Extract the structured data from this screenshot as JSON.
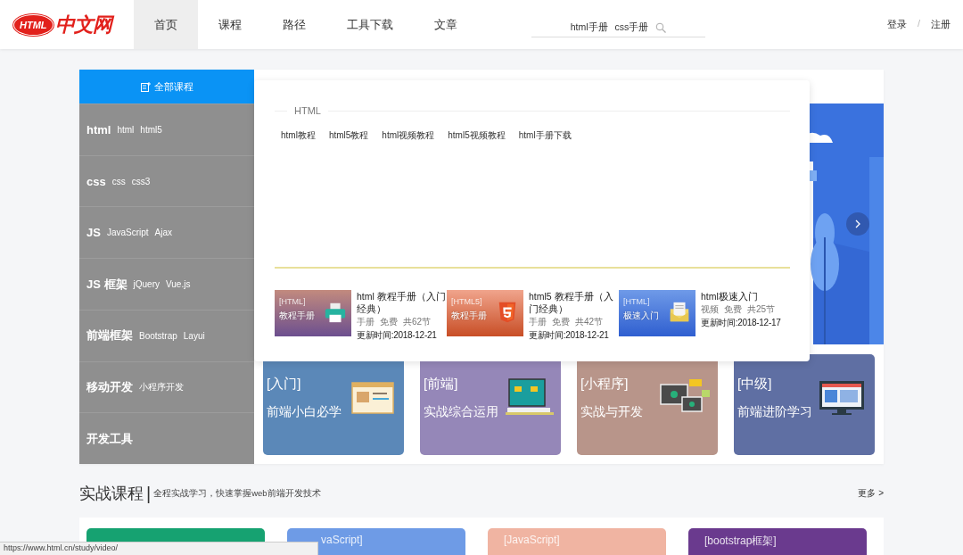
{
  "header": {
    "logo": {
      "badge": "HTML",
      "text": "中文网"
    },
    "nav": [
      {
        "label": "首页",
        "selected": true
      },
      {
        "label": "课程",
        "selected": false
      },
      {
        "label": "路径",
        "selected": false
      },
      {
        "label": "工具下载",
        "selected": false
      },
      {
        "label": "文章",
        "selected": false
      }
    ],
    "search": {
      "links": [
        "html手册",
        "css手册"
      ]
    },
    "auth": {
      "login": "登录",
      "separator": "/",
      "register": "注册"
    }
  },
  "sidebar": {
    "title": "全部课程",
    "categories": [
      {
        "name": "html",
        "tags": [
          "html",
          "html5"
        ]
      },
      {
        "name": "css",
        "tags": [
          "css",
          "css3"
        ]
      },
      {
        "name": "JS",
        "tags": [
          "JavaScript",
          "Ajax"
        ]
      },
      {
        "name": "JS 框架",
        "tags": [
          "jQuery",
          "Vue.js"
        ]
      },
      {
        "name": "前端框架",
        "tags": [
          "Bootstrap",
          "Layui"
        ]
      },
      {
        "name": "移动开发",
        "tags": [
          "小程序开发"
        ]
      },
      {
        "name": "开发工具"
      }
    ]
  },
  "popup": {
    "heading": "HTML",
    "links": [
      "html教程",
      "html5教程",
      "html视频教程",
      "html5视频教程",
      "html手册下载"
    ],
    "courses": [
      {
        "kind": "printer",
        "thumb_tag": "[HTML]",
        "thumb_label": "教程手册",
        "title": "html 教程手册（入门经典）",
        "meta": [
          "手册",
          "免费",
          "共62节"
        ],
        "updated": "更新时间:2018-12-21"
      },
      {
        "kind": "html5",
        "thumb_tag": "[HTML5]",
        "thumb_label": "教程手册",
        "title": "html5 教程手册（入门经典）",
        "meta": [
          "手册",
          "免费",
          "共42节"
        ],
        "updated": "更新时间:2018-12-21"
      },
      {
        "kind": "envelope",
        "thumb_tag": "[HTML]",
        "thumb_label": "极速入门",
        "title": "html极速入门",
        "meta": [
          "视频",
          "免费",
          "共25节"
        ],
        "updated": "更新时间:2018-12-17"
      }
    ]
  },
  "promo_cards": [
    {
      "kind": "browser",
      "tag": "[入门]",
      "title": "前端小白必学",
      "color": "#5b88b8"
    },
    {
      "kind": "desk",
      "tag": "[前端]",
      "title": "实战综合运用",
      "color": "#9587b8"
    },
    {
      "kind": "monitors",
      "tag": "[小程序]",
      "title": "实战与开发",
      "color": "#b8958a"
    },
    {
      "kind": "screen",
      "tag": "[中级]",
      "title": "前端进阶学习",
      "color": "#5f6fa3"
    }
  ],
  "section": {
    "title": "实战课程",
    "separator": "|",
    "subtitle": "全程实战学习，快速掌握web前端开发技术",
    "more": "更多 >"
  },
  "course_cards": [
    {
      "color": "#16a271"
    },
    {
      "color": "#6e9be6",
      "title": "vaScript]"
    },
    {
      "color": "#f0b4a2",
      "title": "[JavaScript]"
    },
    {
      "color": "#6a3a8e",
      "title": "[bootstrap框架]"
    }
  ],
  "status_bar": {
    "url": "https://www.html.cn/study/video/"
  }
}
